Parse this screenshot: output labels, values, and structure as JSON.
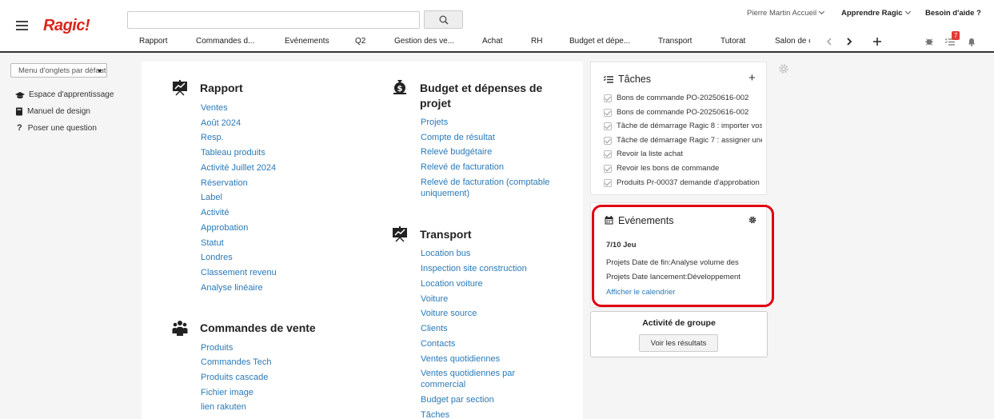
{
  "header": {
    "logo": "Ragic!",
    "search": {
      "value": "",
      "placeholder": ""
    },
    "user": "Pierre Martin Accueil",
    "learn": "Apprendre Ragic",
    "help": "Besoin d'aide ?",
    "tabs": [
      "Rapport",
      "Commandes d...",
      "Evénements",
      "Q2",
      "Gestion des ve...",
      "Achat",
      "RH",
      "Budget et dépe...",
      "Transport",
      "Tutorat",
      "Salon de c"
    ],
    "notification_count": "7"
  },
  "sidebar": {
    "menu_select": "Menu d'onglets par défaut",
    "links": [
      "Espace d'apprentissage",
      "Manuel de design",
      "Poser une question"
    ]
  },
  "main": {
    "rapport": {
      "title": "Rapport",
      "links": [
        "Ventes",
        "Août 2024",
        "Resp.",
        "Tableau produits",
        "Activité Juillet 2024",
        "Réservation",
        "Label",
        "Activité",
        "Approbation",
        "Statut",
        "Londres",
        "Classement revenu",
        "Analyse linéaire"
      ]
    },
    "commandes": {
      "title": "Commandes de vente",
      "links": [
        "Produits",
        "Commandes Tech",
        "Produits cascade",
        "Fichier image",
        "lien rakuten"
      ]
    },
    "budget": {
      "title_line1": "Budget et dépenses de",
      "title_line2": "projet",
      "links": [
        "Projets",
        "Compte de résultat",
        "Relevé budgétaire",
        "Relevé de facturation"
      ],
      "link_multi_line1": "Relevé de facturation (comptable",
      "link_multi_line2": "uniquement)"
    },
    "transport": {
      "title": "Transport",
      "links": [
        "Location bus",
        "Inspection site construction",
        "Location voiture",
        "Voiture",
        "Voiture source",
        "Clients",
        "Contacts",
        "Ventes quotidiennes"
      ],
      "link_multi_line1": "Ventes quotidiennes par",
      "link_multi_line2": "commercial",
      "links_after": [
        "Budget par section",
        "Tâches"
      ]
    }
  },
  "tasks": {
    "title": "Tâches",
    "items": [
      "Bons de commande PO-20250616-002",
      "Bons de commande PO-20250616-002",
      "Tâche de démarrage Ragic 8 : importer vos",
      "Tâche de démarrage Ragic 7 : assigner une",
      "Revoir la liste achat",
      "Revoir les bons de commande",
      "Produits Pr-00037 demande d'approbation"
    ]
  },
  "events": {
    "title": "Evénements",
    "date": "7/10 Jeu",
    "lines": [
      "Projets Date de fin:Analyse volume des",
      "Projets Date lancement:Développement"
    ],
    "calendar_link": "Afficher le calendrier"
  },
  "group": {
    "title": "Activité de groupe",
    "button": "Voir les résultats"
  },
  "colors": {
    "brand": "#d9261c",
    "link": "#2a7ab8",
    "highlight": "#e00012",
    "badge": "#e53935"
  }
}
